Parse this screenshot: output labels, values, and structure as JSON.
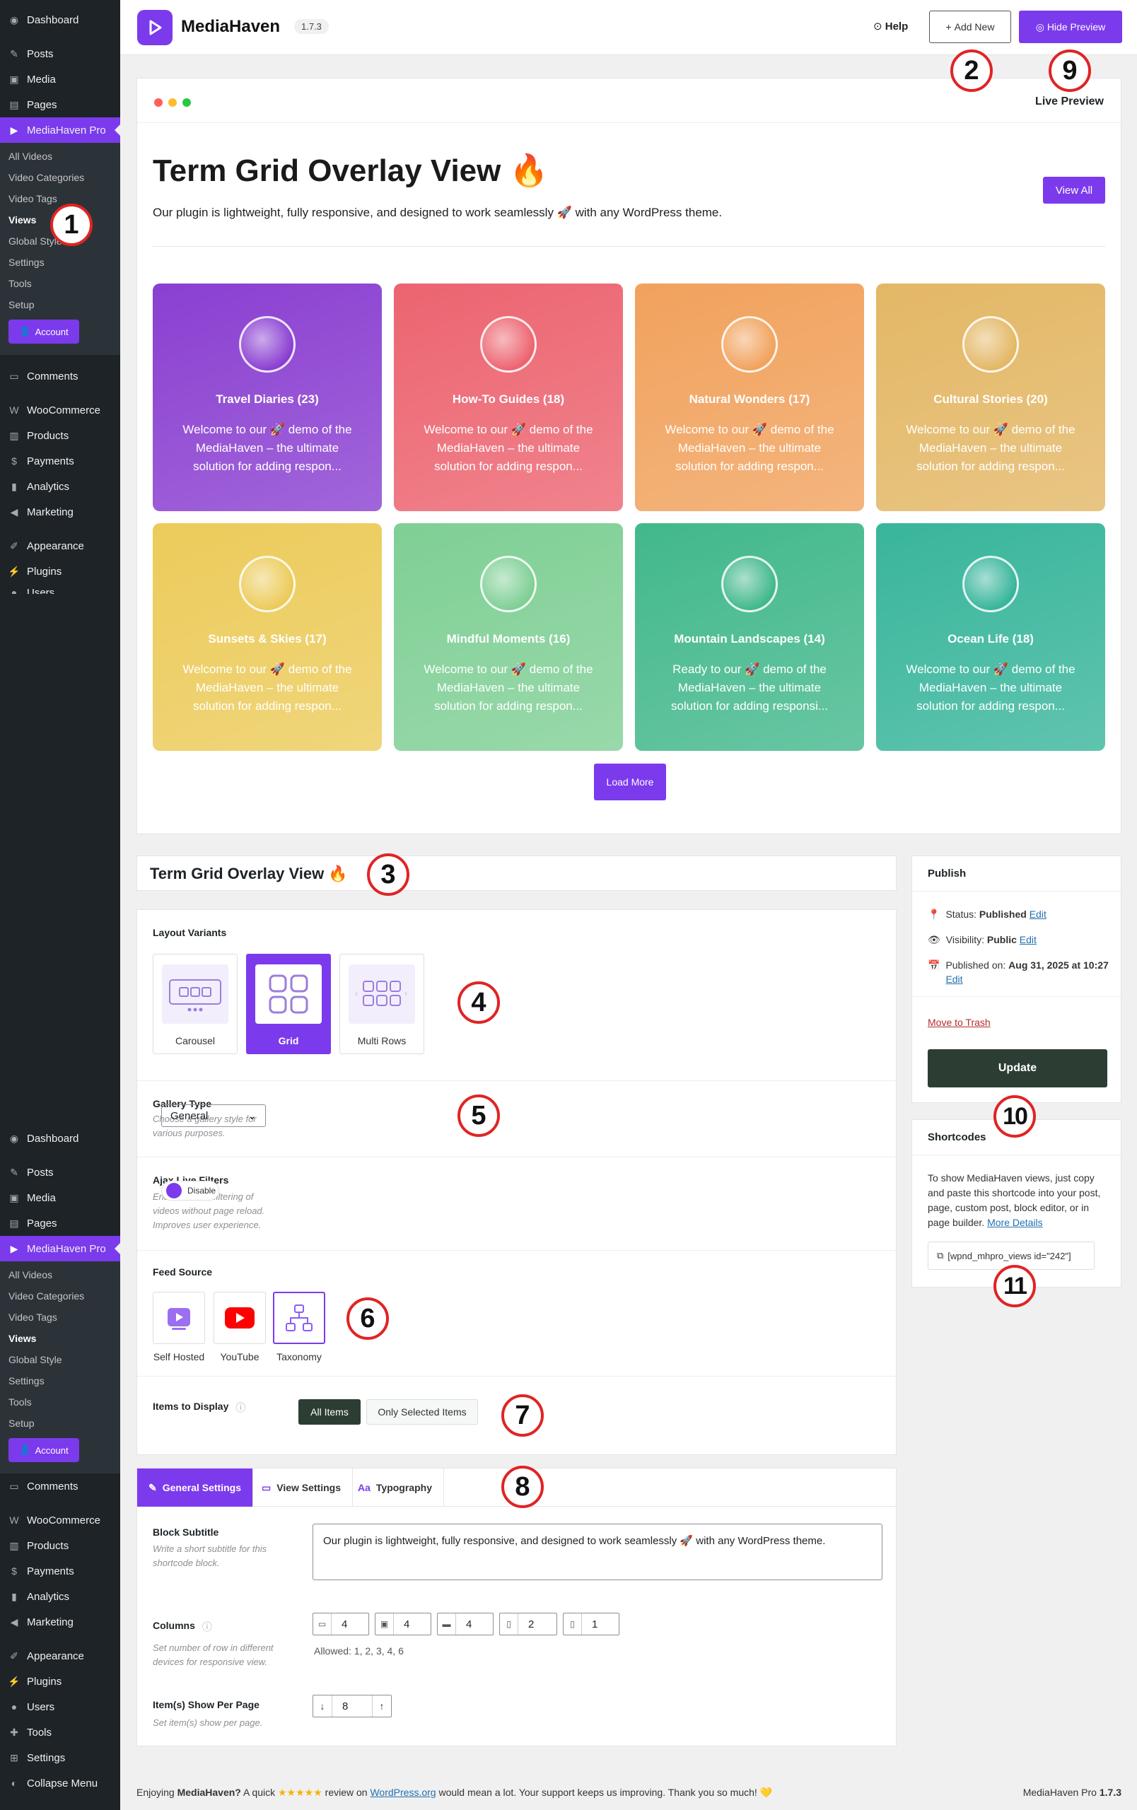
{
  "sidebar_top": {
    "items_a": [
      {
        "label": "Dashboard",
        "icon": "dashboard-icon"
      },
      {
        "label": "Posts",
        "icon": "pin-icon"
      },
      {
        "label": "Media",
        "icon": "media-icon"
      },
      {
        "label": "Pages",
        "icon": "pages-icon"
      }
    ],
    "active": "MediaHaven Pro",
    "sub": [
      "All Videos",
      "Video Categories",
      "Video Tags",
      "Views",
      "Global Style",
      "Settings",
      "Tools",
      "Setup"
    ],
    "current_sub": "Views",
    "account": "Account",
    "items_b": [
      {
        "label": "Comments",
        "icon": "comments-icon"
      },
      {
        "label": "WooCommerce",
        "icon": "woo-icon"
      },
      {
        "label": "Products",
        "icon": "products-icon"
      },
      {
        "label": "Payments",
        "icon": "payments-icon"
      },
      {
        "label": "Analytics",
        "icon": "analytics-icon"
      },
      {
        "label": "Marketing",
        "icon": "marketing-icon"
      },
      {
        "label": "Appearance",
        "icon": "brush-icon"
      },
      {
        "label": "Plugins",
        "icon": "plugin-icon"
      }
    ],
    "cut_item": "Users"
  },
  "sidebar_bottom": {
    "items_c": [
      {
        "label": "Comments",
        "icon": "comments-icon"
      },
      {
        "label": "WooCommerce",
        "icon": "woo-icon"
      },
      {
        "label": "Products",
        "icon": "products-icon"
      },
      {
        "label": "Payments",
        "icon": "payments-icon"
      },
      {
        "label": "Analytics",
        "icon": "analytics-icon"
      },
      {
        "label": "Marketing",
        "icon": "marketing-icon"
      },
      {
        "label": "Appearance",
        "icon": "brush-icon"
      },
      {
        "label": "Plugins",
        "icon": "plugin-icon"
      },
      {
        "label": "Users",
        "icon": "users-icon"
      },
      {
        "label": "Tools",
        "icon": "tools-icon"
      },
      {
        "label": "Settings",
        "icon": "settings-icon"
      },
      {
        "label": "Collapse Menu",
        "icon": "collapse-icon"
      }
    ]
  },
  "topbar": {
    "brand": "MediaHaven",
    "version": "1.7.3",
    "help": "Help",
    "add_new": "Add New",
    "hide_preview": "Hide Preview"
  },
  "markers": [
    "1",
    "2",
    "3",
    "4",
    "5",
    "6",
    "7",
    "8",
    "9",
    "10",
    "11"
  ],
  "preview": {
    "live_label": "Live Preview",
    "title": "Term Grid Overlay View 🔥",
    "subtitle": "Our plugin is lightweight, fully responsive, and designed to work seamlessly 🚀 with any WordPress theme.",
    "view_all": "View All",
    "load_more": "Load More",
    "cards": [
      {
        "title": "Travel Diaries (23)",
        "desc": "Welcome to our 🚀 demo of the MediaHaven – the ultimate solution for adding respon...",
        "color": "#8a3fd1"
      },
      {
        "title": "How-To Guides (18)",
        "desc": "Welcome to our 🚀 demo of the MediaHaven – the ultimate solution for adding respon...",
        "color": "#ec6470"
      },
      {
        "title": "Natural Wonders (17)",
        "desc": "Welcome to our 🚀 demo of the MediaHaven – the ultimate solution for adding respon...",
        "color": "#f1a25d"
      },
      {
        "title": "Cultural Stories (20)",
        "desc": "Welcome to our 🚀 demo of the MediaHaven – the ultimate solution for adding respon...",
        "color": "#e3b765"
      },
      {
        "title": "Sunsets & Skies (17)",
        "desc": "Welcome to our 🚀 demo of the MediaHaven – the ultimate solution for adding respon...",
        "color": "#eccb5a"
      },
      {
        "title": "Mindful Moments (16)",
        "desc": "Welcome to our 🚀 demo of the MediaHaven – the ultimate solution for adding respon...",
        "color": "#7fcf95"
      },
      {
        "title": "Mountain Landscapes (14)",
        "desc": "Ready to our 🚀 demo of the MediaHaven – the ultimate solution for adding responsi...",
        "color": "#42b88c"
      },
      {
        "title": "Ocean Life (18)",
        "desc": "Welcome to our 🚀 demo of the MediaHaven – the ultimate solution for adding respon...",
        "color": "#38b59b"
      }
    ]
  },
  "editor": {
    "view_name": "Term Grid Overlay View 🔥",
    "layout_label": "Layout Variants",
    "variants": [
      "Carousel",
      "Grid",
      "Multi Rows"
    ],
    "selected_variant": "Grid",
    "gallery_label": "Gallery Type",
    "gallery_hint": "Choose a gallery style for various purposes.",
    "gallery_value": "General",
    "ajax_label": "Ajax Live Filters",
    "ajax_hint": "Enable instant filtering of videos without page reload. Improves user experience.",
    "ajax_value": "Disable",
    "feed_label": "Feed Source",
    "feeds": [
      "Self Hosted",
      "YouTube",
      "Taxonomy"
    ],
    "selected_feed": "Taxonomy",
    "items_label": "Items to Display",
    "items_all": "All Items",
    "items_selected": "Only Selected Items"
  },
  "tabs": {
    "labels": [
      "General Settings",
      "View Settings",
      "Typography"
    ],
    "active": "General Settings",
    "subtitle_label": "Block Subtitle",
    "subtitle_hint": "Write a short subtitle for this shortcode block.",
    "subtitle_value": "Our plugin is lightweight, fully responsive, and designed to work seamlessly 🚀 with any WordPress theme.",
    "columns_label": "Columns",
    "columns_hint": "Set number of row in different devices for responsive view.",
    "columns": [
      "4",
      "4",
      "4",
      "2",
      "1"
    ],
    "allowed": "Allowed: 1, 2, 3, 4, 6",
    "perpage_label": "Item(s) Show Per Page",
    "perpage_hint": "Set item(s) show per page.",
    "perpage_value": "8"
  },
  "publish": {
    "title": "Publish",
    "status_label": "Status:",
    "status_value": "Published",
    "visibility_label": "Visibility:",
    "visibility_value": "Public",
    "published_label": "Published on:",
    "published_value": "Aug 31, 2025 at 10:27",
    "edit": "Edit",
    "trash": "Move to Trash",
    "update": "Update"
  },
  "shortcodes": {
    "title": "Shortcodes",
    "text": "To show MediaHaven views, just copy and paste this shortcode into your post, page, custom post, block editor, or in page builder.",
    "more": "More Details",
    "code": "[wpnd_mhpro_views id=\"242\"]"
  },
  "footer": {
    "enjoying": "Enjoying",
    "brand": "MediaHaven?",
    "quick": "A quick",
    "stars": "★★★★★",
    "review_on": "review on",
    "wp": "WordPress.org",
    "rest": "would mean a lot. Your support keeps us improving. Thank you so much! 💛",
    "right_name": "MediaHaven Pro",
    "right_ver": "1.7.3"
  },
  "colors": {
    "accent": "#7c3aed",
    "sidebar": "#1d2327",
    "update": "#2c3e34",
    "marker": "#e02424"
  }
}
